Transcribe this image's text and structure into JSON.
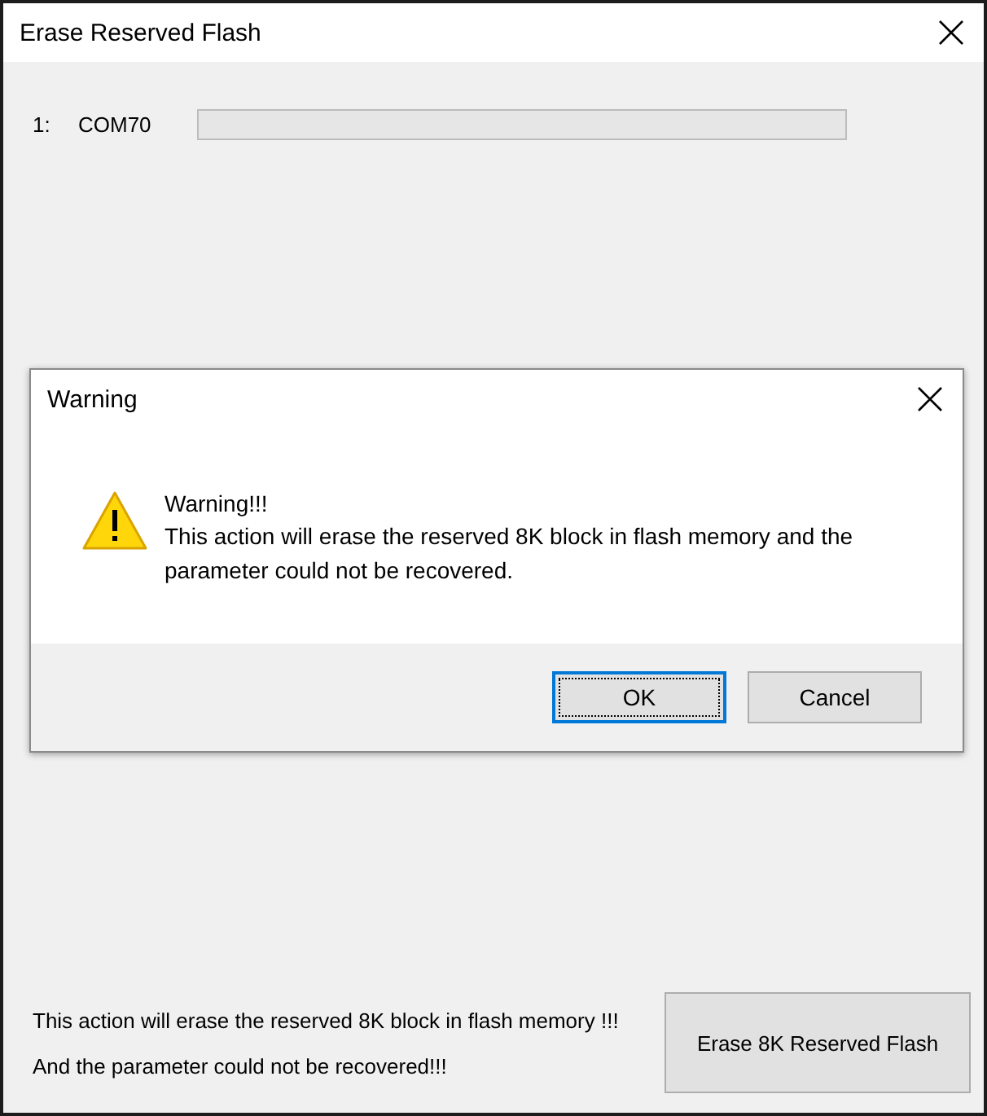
{
  "window": {
    "title": "Erase Reserved Flash"
  },
  "ports": [
    {
      "index": "1:",
      "name": "COM70",
      "level": 0
    }
  ],
  "footer": {
    "lines": [
      "This action will erase the reserved 8K block in flash memory !!!",
      "And the parameter could not be recovered!!!"
    ],
    "button": "Erase 8K Reserved Flash"
  },
  "dialog": {
    "title": "Warning",
    "heading": "Warning!!!",
    "message": "This action will erase the reserved 8K block in flash memory and the parameter could not be recovered.",
    "buttons": [
      {
        "label": "OK",
        "default": true
      },
      {
        "label": "Cancel",
        "default": false
      }
    ]
  }
}
